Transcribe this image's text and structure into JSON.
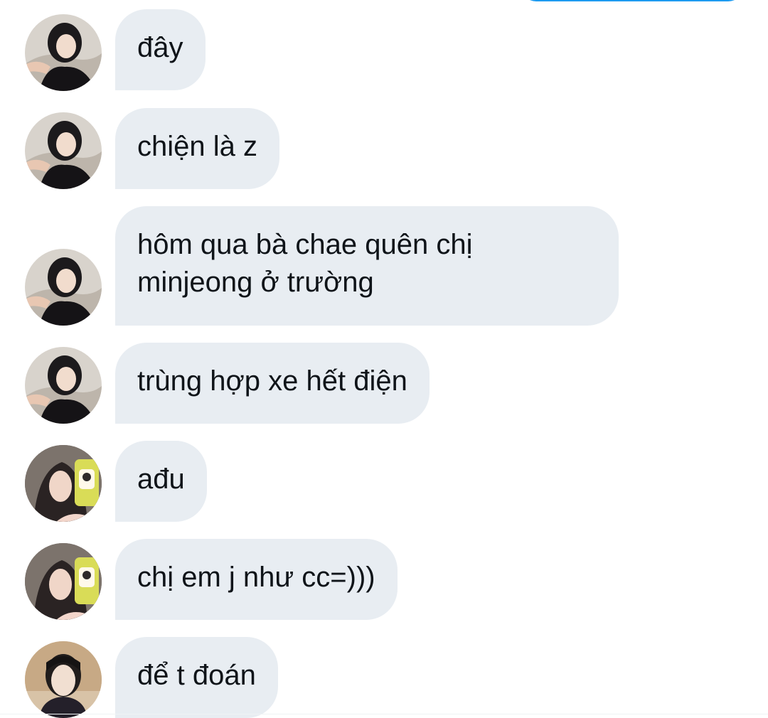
{
  "conversation": {
    "accent_color": "#1d9bf0",
    "bubble_color": "#e8edf2",
    "messages": [
      {
        "sender": "user-a",
        "avatar_icon": "user-avatar-a",
        "text": "đây"
      },
      {
        "sender": "user-a",
        "avatar_icon": "user-avatar-a",
        "text": "chiện là z"
      },
      {
        "sender": "user-a",
        "avatar_icon": "user-avatar-a",
        "text": "hôm qua bà chae quên chị\nminjeong ở trường"
      },
      {
        "sender": "user-a",
        "avatar_icon": "user-avatar-a",
        "text": "trùng hợp xe hết điện"
      },
      {
        "sender": "user-b",
        "avatar_icon": "user-avatar-b",
        "text": "ađu"
      },
      {
        "sender": "user-b",
        "avatar_icon": "user-avatar-b",
        "text": "chị em j như cc=)))"
      },
      {
        "sender": "user-c",
        "avatar_icon": "user-avatar-c",
        "text": "để t đoán"
      }
    ]
  }
}
